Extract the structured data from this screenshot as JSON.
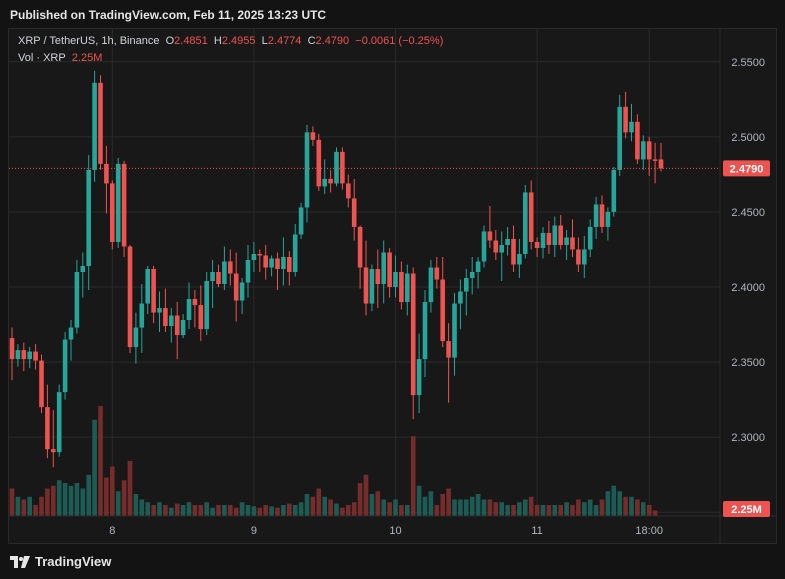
{
  "header": {
    "published": "Published on TradingView.com, Feb 11, 2025 13:23 UTC"
  },
  "legend": {
    "symbol": "XRP / TetherUS, 1h, Binance",
    "o_label": "O",
    "o_value": "2.4851",
    "h_label": "H",
    "h_value": "2.4955",
    "l_label": "L",
    "l_value": "2.4774",
    "c_label": "C",
    "c_value": "2.4790",
    "change": "−0.0061 (−0.25%)",
    "vol_label": "Vol · XRP",
    "vol_value": "2.25M"
  },
  "footer": {
    "brand": "TradingView"
  },
  "colors": {
    "up": "#26a69a",
    "down": "#ef5350",
    "bg": "#181818",
    "grid": "#2a2a2a",
    "price_line": "#ef5350"
  },
  "chart_data": {
    "type": "candlestick",
    "ylim": [
      2.2475,
      2.5725
    ],
    "yticks": [
      "2.2500",
      "2.3000",
      "2.3500",
      "2.4000",
      "2.4500",
      "2.5000",
      "2.5500"
    ],
    "xticks": [
      {
        "i": 17,
        "label": "8"
      },
      {
        "i": 41,
        "label": "9"
      },
      {
        "i": 65,
        "label": "10"
      },
      {
        "i": 89,
        "label": "11"
      },
      {
        "i": 108,
        "label": "18:00"
      }
    ],
    "last_price": "2.4790",
    "last_volume": "2.25M",
    "candles": [
      [
        2.366,
        2.373,
        2.338,
        2.352
      ],
      [
        2.352,
        2.362,
        2.347,
        2.358
      ],
      [
        2.358,
        2.363,
        2.344,
        2.352
      ],
      [
        2.352,
        2.36,
        2.346,
        2.357
      ],
      [
        2.357,
        2.362,
        2.345,
        2.351
      ],
      [
        2.351,
        2.355,
        2.316,
        2.32
      ],
      [
        2.32,
        2.335,
        2.286,
        2.292
      ],
      [
        2.292,
        2.318,
        2.28,
        2.29
      ],
      [
        2.29,
        2.335,
        2.287,
        2.33
      ],
      [
        2.33,
        2.37,
        2.325,
        2.365
      ],
      [
        2.365,
        2.378,
        2.351,
        2.373
      ],
      [
        2.373,
        2.418,
        2.369,
        2.41
      ],
      [
        2.41,
        2.423,
        2.393,
        2.414
      ],
      [
        2.414,
        2.488,
        2.398,
        2.478
      ],
      [
        2.478,
        2.544,
        2.47,
        2.536
      ],
      [
        2.536,
        2.541,
        2.478,
        2.482
      ],
      [
        2.482,
        2.494,
        2.449,
        2.469
      ],
      [
        2.469,
        2.471,
        2.425,
        2.43
      ],
      [
        2.43,
        2.486,
        2.426,
        2.482
      ],
      [
        2.482,
        2.484,
        2.42,
        2.427
      ],
      [
        2.427,
        2.428,
        2.356,
        2.36
      ],
      [
        2.36,
        2.383,
        2.349,
        2.373
      ],
      [
        2.373,
        2.402,
        2.356,
        2.389
      ],
      [
        2.389,
        2.414,
        2.382,
        2.412
      ],
      [
        2.412,
        2.414,
        2.376,
        2.383
      ],
      [
        2.383,
        2.397,
        2.37,
        2.386
      ],
      [
        2.386,
        2.399,
        2.37,
        2.374
      ],
      [
        2.374,
        2.386,
        2.363,
        2.381
      ],
      [
        2.381,
        2.39,
        2.352,
        2.368
      ],
      [
        2.368,
        2.382,
        2.366,
        2.378
      ],
      [
        2.378,
        2.403,
        2.372,
        2.392
      ],
      [
        2.392,
        2.398,
        2.373,
        2.388
      ],
      [
        2.388,
        2.401,
        2.364,
        2.372
      ],
      [
        2.372,
        2.41,
        2.368,
        2.404
      ],
      [
        2.404,
        2.418,
        2.386,
        2.41
      ],
      [
        2.41,
        2.415,
        2.4,
        2.402
      ],
      [
        2.402,
        2.427,
        2.398,
        2.417
      ],
      [
        2.417,
        2.425,
        2.401,
        2.409
      ],
      [
        2.409,
        2.423,
        2.377,
        2.391
      ],
      [
        2.391,
        2.406,
        2.382,
        2.403
      ],
      [
        2.403,
        2.428,
        2.393,
        2.418
      ],
      [
        2.418,
        2.43,
        2.41,
        2.422
      ],
      [
        2.422,
        2.425,
        2.41,
        2.421
      ],
      [
        2.421,
        2.428,
        2.405,
        2.413
      ],
      [
        2.413,
        2.421,
        2.407,
        2.419
      ],
      [
        2.419,
        2.423,
        2.398,
        2.412
      ],
      [
        2.412,
        2.433,
        2.401,
        2.42
      ],
      [
        2.42,
        2.424,
        2.401,
        2.41
      ],
      [
        2.41,
        2.442,
        2.407,
        2.435
      ],
      [
        2.435,
        2.456,
        2.432,
        2.453
      ],
      [
        2.453,
        2.508,
        2.443,
        2.503
      ],
      [
        2.503,
        2.507,
        2.494,
        2.498
      ],
      [
        2.498,
        2.502,
        2.464,
        2.467
      ],
      [
        2.467,
        2.485,
        2.462,
        2.472
      ],
      [
        2.472,
        2.478,
        2.463,
        2.469
      ],
      [
        2.469,
        2.493,
        2.467,
        2.49
      ],
      [
        2.49,
        2.493,
        2.465,
        2.469
      ],
      [
        2.469,
        2.475,
        2.453,
        2.459
      ],
      [
        2.459,
        2.472,
        2.431,
        2.44
      ],
      [
        2.44,
        2.441,
        2.399,
        2.413
      ],
      [
        2.413,
        2.431,
        2.381,
        2.389
      ],
      [
        2.389,
        2.415,
        2.384,
        2.412
      ],
      [
        2.412,
        2.425,
        2.386,
        2.402
      ],
      [
        2.402,
        2.431,
        2.389,
        2.423
      ],
      [
        2.423,
        2.426,
        2.393,
        2.4
      ],
      [
        2.4,
        2.421,
        2.393,
        2.41
      ],
      [
        2.41,
        2.417,
        2.385,
        2.39
      ],
      [
        2.39,
        2.415,
        2.381,
        2.409
      ],
      [
        2.409,
        2.413,
        2.312,
        2.328
      ],
      [
        2.328,
        2.369,
        2.316,
        2.352
      ],
      [
        2.352,
        2.398,
        2.34,
        2.39
      ],
      [
        2.39,
        2.418,
        2.383,
        2.413
      ],
      [
        2.413,
        2.42,
        2.399,
        2.405
      ],
      [
        2.405,
        2.42,
        2.36,
        2.364
      ],
      [
        2.364,
        2.376,
        2.323,
        2.353
      ],
      [
        2.353,
        2.396,
        2.341,
        2.389
      ],
      [
        2.389,
        2.405,
        2.372,
        2.397
      ],
      [
        2.397,
        2.412,
        2.381,
        2.406
      ],
      [
        2.406,
        2.42,
        2.395,
        2.41
      ],
      [
        2.41,
        2.42,
        2.399,
        2.417
      ],
      [
        2.417,
        2.441,
        2.413,
        2.437
      ],
      [
        2.437,
        2.454,
        2.426,
        2.431
      ],
      [
        2.431,
        2.438,
        2.418,
        2.423
      ],
      [
        2.423,
        2.437,
        2.404,
        2.428
      ],
      [
        2.428,
        2.44,
        2.421,
        2.432
      ],
      [
        2.432,
        2.441,
        2.41,
        2.415
      ],
      [
        2.415,
        2.432,
        2.406,
        2.422
      ],
      [
        2.422,
        2.468,
        2.419,
        2.463
      ],
      [
        2.463,
        2.471,
        2.425,
        2.43
      ],
      [
        2.43,
        2.433,
        2.42,
        2.426
      ],
      [
        2.426,
        2.44,
        2.419,
        2.436
      ],
      [
        2.436,
        2.444,
        2.422,
        2.428
      ],
      [
        2.428,
        2.447,
        2.42,
        2.441
      ],
      [
        2.441,
        2.448,
        2.425,
        2.428
      ],
      [
        2.428,
        2.438,
        2.418,
        2.433
      ],
      [
        2.433,
        2.445,
        2.42,
        2.425
      ],
      [
        2.425,
        2.433,
        2.41,
        2.415
      ],
      [
        2.415,
        2.434,
        2.406,
        2.425
      ],
      [
        2.425,
        2.445,
        2.42,
        2.44
      ],
      [
        2.44,
        2.46,
        2.432,
        2.455
      ],
      [
        2.455,
        2.461,
        2.436,
        2.44
      ],
      [
        2.44,
        2.453,
        2.431,
        2.45
      ],
      [
        2.45,
        2.48,
        2.447,
        2.478
      ],
      [
        2.478,
        2.528,
        2.474,
        2.52
      ],
      [
        2.52,
        2.53,
        2.499,
        2.503
      ],
      [
        2.503,
        2.522,
        2.497,
        2.51
      ],
      [
        2.51,
        2.515,
        2.482,
        2.485
      ],
      [
        2.485,
        2.501,
        2.478,
        2.497
      ],
      [
        2.497,
        2.5,
        2.474,
        2.485
      ],
      [
        2.485,
        2.496,
        2.469,
        2.484
      ],
      [
        2.485,
        2.496,
        2.477,
        2.479
      ]
    ],
    "volume": [
      20,
      14,
      12,
      14,
      8,
      14,
      20,
      22,
      26,
      24,
      22,
      24,
      20,
      30,
      70,
      80,
      28,
      36,
      18,
      26,
      40,
      16,
      12,
      10,
      8,
      10,
      8,
      6,
      9,
      8,
      10,
      8,
      8,
      10,
      6,
      8,
      8,
      8,
      6,
      10,
      8,
      7,
      6,
      8,
      7,
      6,
      8,
      9,
      8,
      10,
      16,
      14,
      20,
      14,
      12,
      9,
      6,
      8,
      10,
      24,
      30,
      16,
      18,
      12,
      10,
      12,
      8,
      8,
      58,
      22,
      14,
      18,
      8,
      16,
      20,
      12,
      12,
      12,
      14,
      16,
      12,
      12,
      10,
      10,
      8,
      8,
      10,
      12,
      14,
      8,
      8,
      8,
      8,
      8,
      10,
      8,
      12,
      10,
      12,
      8,
      12,
      18,
      22,
      18,
      14,
      14,
      12,
      10,
      8,
      4
    ],
    "volume_max": 80
  }
}
